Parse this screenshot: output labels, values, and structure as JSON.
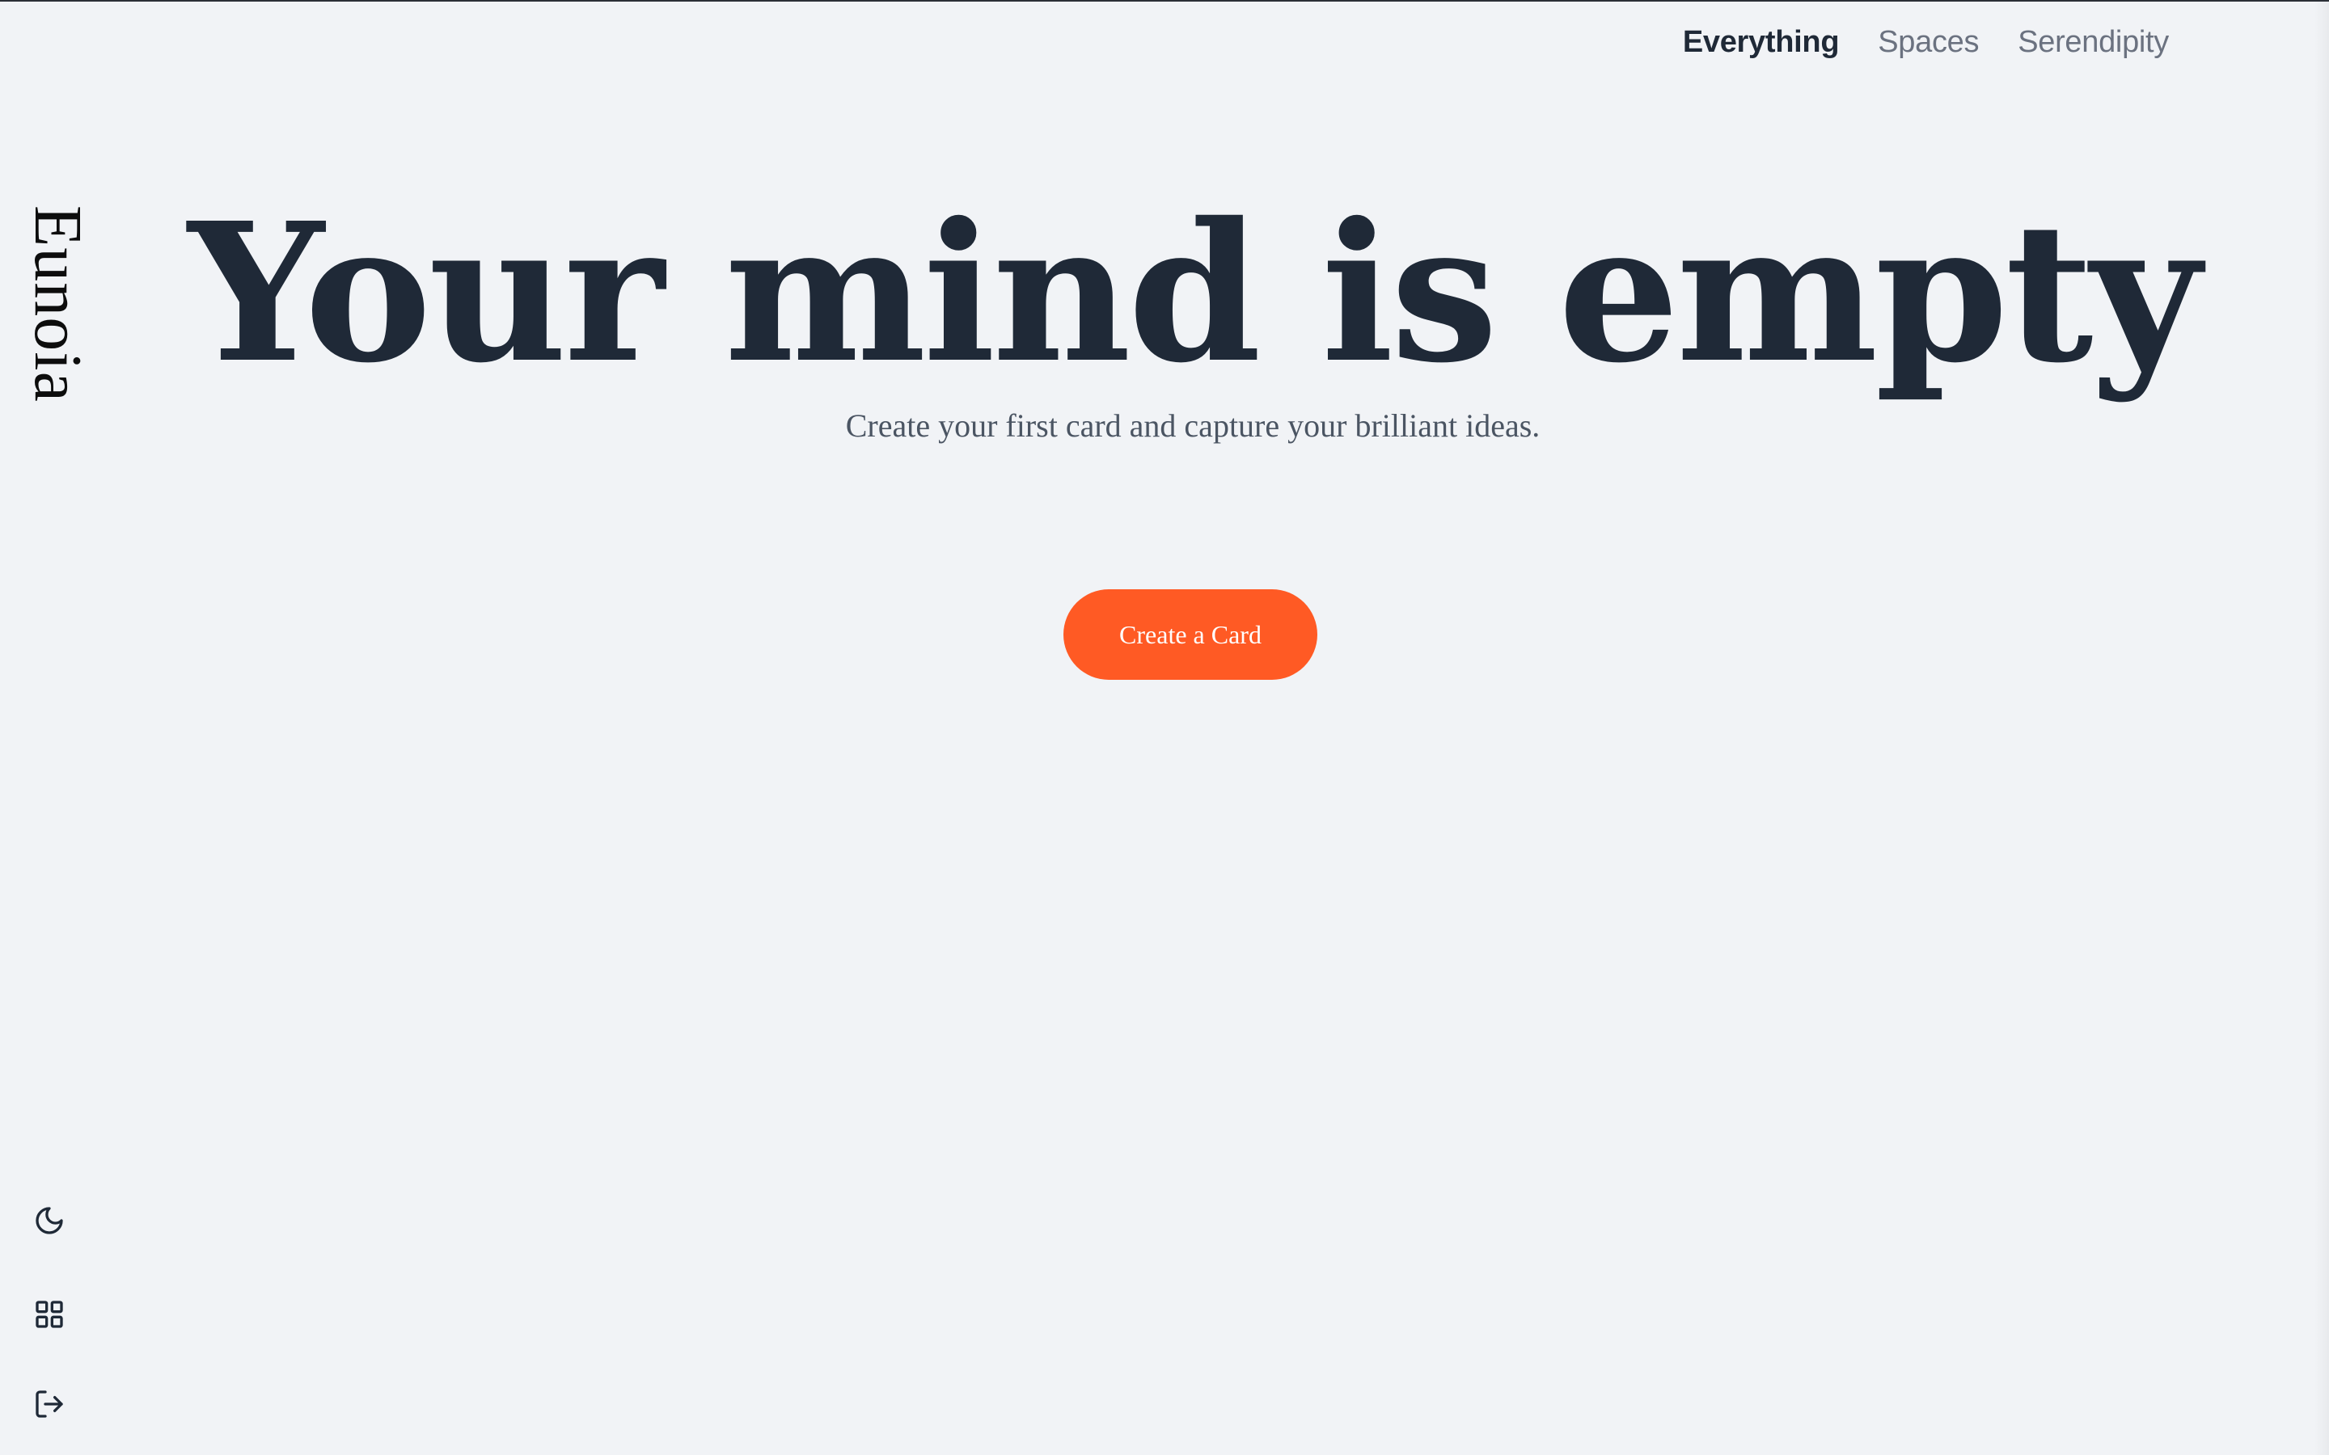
{
  "brand": {
    "name": "Eunoia"
  },
  "topnav": {
    "items": [
      {
        "label": "Everything",
        "active": true
      },
      {
        "label": "Spaces",
        "active": false
      },
      {
        "label": "Serendipity",
        "active": false
      }
    ]
  },
  "hero": {
    "title": "Your mind is empty",
    "subtitle": "Create your first card and capture your brilliant ideas.",
    "cta_label": "Create a Card"
  },
  "sidebar": {
    "icons": [
      {
        "name": "moon-icon",
        "action": "toggle-dark-mode"
      },
      {
        "name": "grid-icon",
        "action": "toggle-layout"
      },
      {
        "name": "logout-icon",
        "action": "logout"
      }
    ]
  },
  "colors": {
    "background": "#f1f3f6",
    "text": "#1f2937",
    "muted": "#6b7280",
    "accent": "#ff5a24"
  }
}
